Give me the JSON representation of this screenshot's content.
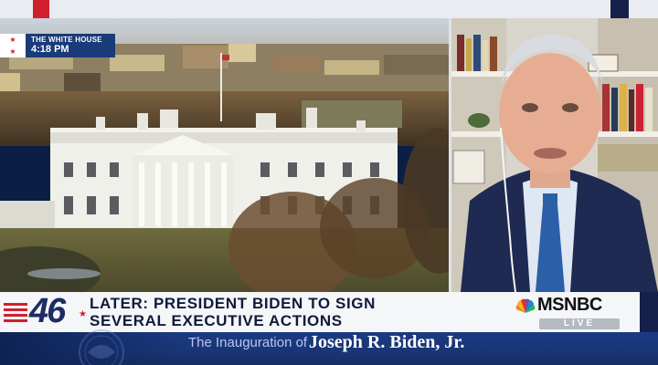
{
  "location_bug": {
    "location": "THE WHITE HOUSE",
    "time": "4:18 PM"
  },
  "lower_third": {
    "number": "46",
    "headline_line1": "LATER: PRESIDENT BIDEN TO SIGN",
    "headline_line2": "SEVERAL EXECUTIVE ACTIONS"
  },
  "brand": {
    "name": "MSNBC",
    "status": "LIVE"
  },
  "ticker": {
    "prefix": "The Inauguration of",
    "name": "Joseph R. Biden, Jr."
  },
  "colors": {
    "brand_navy": "#1a3a7a",
    "accent_red": "#d21f2e",
    "ticker_blue": "#1b3a82",
    "lower_third_bg": "#f4f6f8"
  }
}
